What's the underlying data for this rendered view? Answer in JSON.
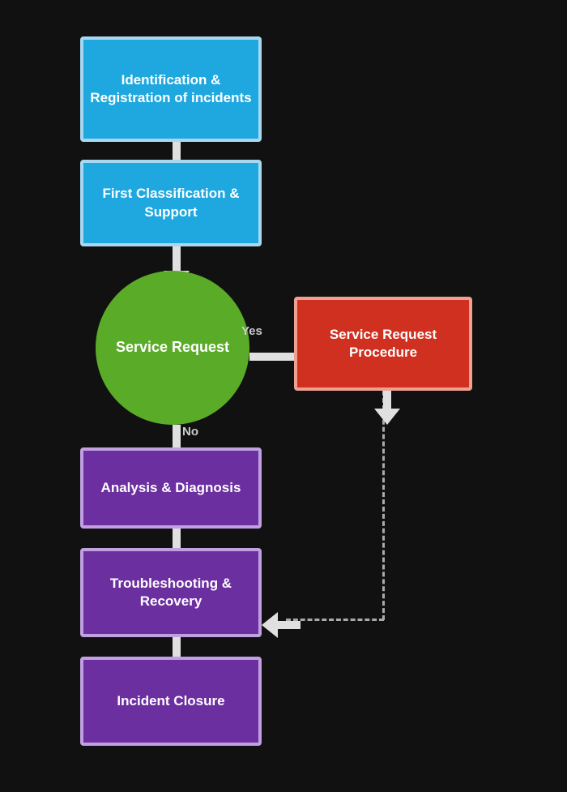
{
  "boxes": {
    "identification": "Identification & Registration of incidents",
    "classification": "First Classification & Support",
    "service_request": "Service Request",
    "service_request_procedure": "Service Request Procedure",
    "analysis": "Analysis & Diagnosis",
    "troubleshooting": "Troubleshooting & Recovery",
    "closure": "Incident Closure"
  },
  "labels": {
    "yes": "Yes",
    "no": "No"
  }
}
